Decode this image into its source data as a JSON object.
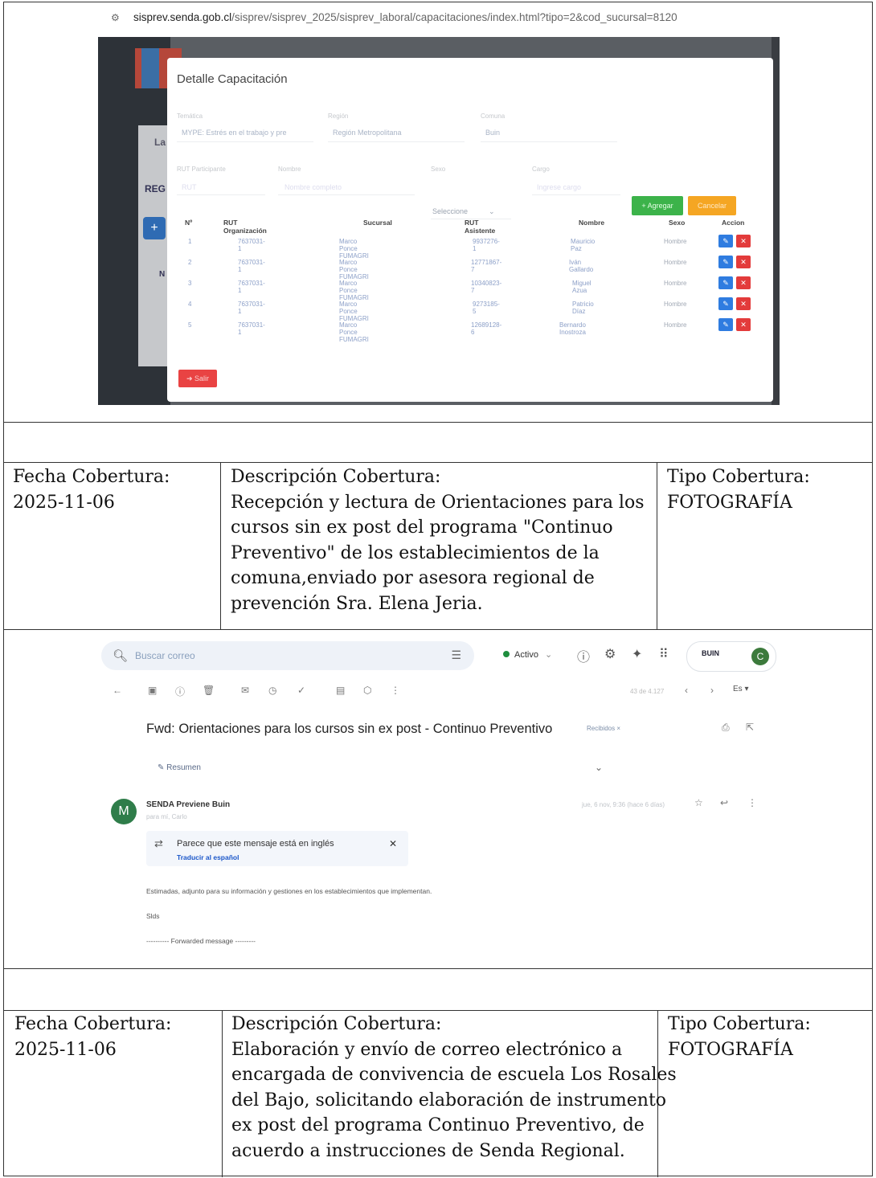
{
  "section1": {
    "url": {
      "host": "sisprev.senda.gob.cl",
      "path": "/sisprev/sisprev_2025/sisprev_laboral/capacitaciones/index.html?tipo=2&cod_sucursal=8120"
    },
    "background": {
      "text_la": "La",
      "text_reg": "REG",
      "text_n": "N"
    },
    "modal": {
      "title": "Detalle Capacitación",
      "fields": {
        "tematica_label": "Temática",
        "tematica_value": "MYPE: Estrés en el trabajo y pre",
        "region_label": "Región",
        "region_value": "Región Metropolitana",
        "comuna_label": "Comuna",
        "comuna_value": "Buin",
        "rut_label": "RUT Participante",
        "rut_placeholder": "RUT",
        "nombre_label": "Nombre",
        "nombre_placeholder": "Nombre completo",
        "sexo_label": "Sexo",
        "sexo_value": "Seleccione",
        "cargo_label": "Cargo",
        "cargo_placeholder": "Ingrese cargo"
      },
      "add_label": "+ Agregar",
      "cancel_label": "Cancelar",
      "table": {
        "headers": [
          "Nº",
          "RUT Organización",
          "Sucursal",
          "RUT Asistente",
          "Nombre",
          "Sexo",
          "Accion"
        ],
        "rows": [
          [
            "1",
            "7637031-1",
            "Marco Ponce FUMAGRI",
            "9937276-1",
            "Mauricio Paz",
            "Hombre"
          ],
          [
            "2",
            "7637031-1",
            "Marco Ponce FUMAGRI",
            "12771867-7",
            "Iván Gallardo",
            "Hombre"
          ],
          [
            "3",
            "7637031-1",
            "Marco Ponce FUMAGRI",
            "10340823-7",
            "Miguel Azua",
            "Hombre"
          ],
          [
            "4",
            "7637031-1",
            "Marco Ponce FUMAGRI",
            "9273185-5",
            "Patricio Díaz",
            "Hombre"
          ],
          [
            "5",
            "7637031-1",
            "Marco Ponce FUMAGRI",
            "12689128-6",
            "Bernardo Inostroza",
            "Hombre"
          ]
        ]
      },
      "exit_label": "Salir"
    }
  },
  "section2": {
    "fecha_label": "Fecha Cobertura:",
    "fecha_value": "2025-11-06",
    "desc_label": "Descripción Cobertura:",
    "desc_lines": [
      "Recepción y lectura de  Orientaciones para los",
      "cursos sin ex post del programa \"Continuo",
      "Preventivo\" de los establecimientos de la",
      "comuna,enviado por asesora regional de",
      "prevención Sra. Elena Jeria."
    ],
    "tipo_label": "Tipo Cobertura:",
    "tipo_value": "FOTOGRAFÍA"
  },
  "section3": {
    "search_placeholder": "Buscar correo",
    "status": "Activo",
    "account_logo": "BUIN",
    "avatar_letter": "C",
    "pagination": "43 de 4.127",
    "lang": "Es",
    "subject": "Fwd: Orientaciones para los cursos sin ex post - Continuo Preventivo",
    "label_inbox": "Recibidos ×",
    "summary": "Resumen",
    "sender_initial": "M",
    "sender": "SENDA Previene Buin",
    "to": "para mí, Carlo",
    "date": "jue, 6 nov, 9:36 (hace 6 días)",
    "translate_title": "Parece que este mensaje está en inglés",
    "translate_link": "Traducir al español",
    "body_line1": "Estimadas, adjunto para su información y gestiones en los establecimientos que implementan.",
    "body_line2": "Slds",
    "body_line3": "---------- Forwarded message ---------"
  },
  "section4": {
    "fecha_label": "Fecha Cobertura:",
    "fecha_value": "2025-11-06",
    "desc_label": "Descripción Cobertura:",
    "desc_lines": [
      "Elaboración y envío de correo electrónico a",
      "encargada de convivencia de escuela Los Rosales",
      "del Bajo, solicitando elaboración de instrumento",
      "ex post del programa Continuo Preventivo, de",
      "acuerdo a instrucciones de Senda Regional."
    ],
    "tipo_label": "Tipo Cobertura:",
    "tipo_value": "FOTOGRAFÍA"
  }
}
